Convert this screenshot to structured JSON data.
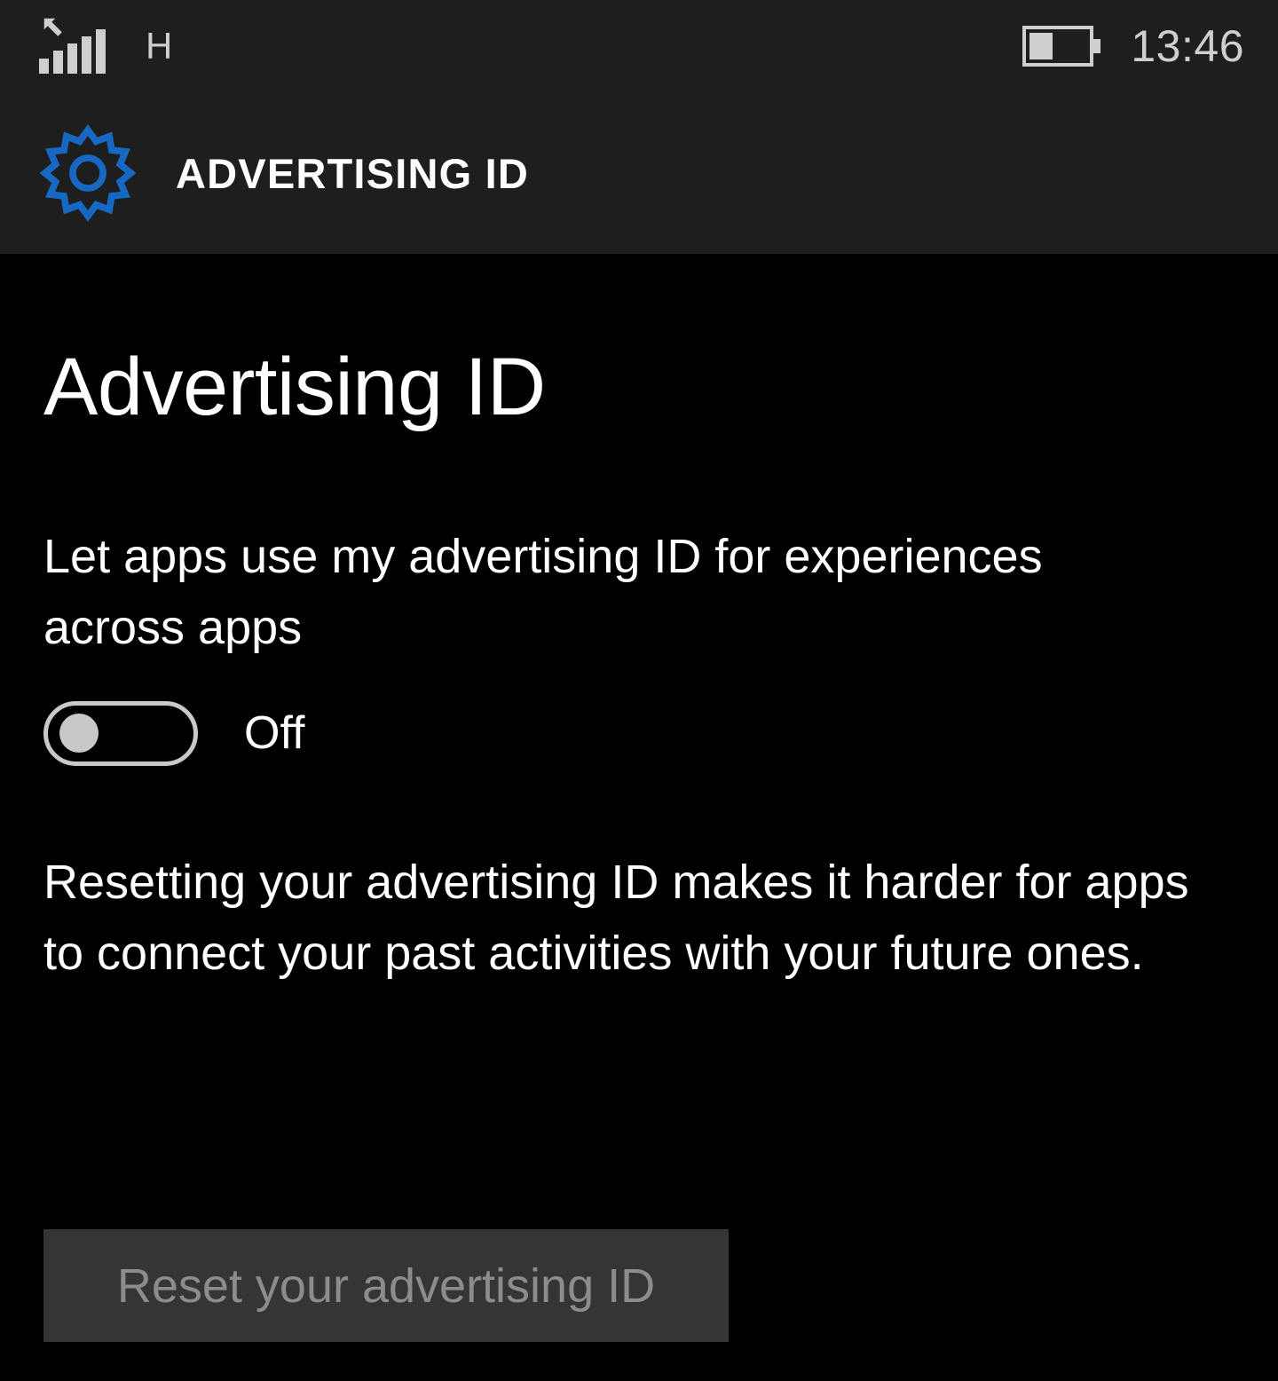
{
  "status_bar": {
    "signal_icon": "signal-bars-icon",
    "signal_bars_filled": 5,
    "signal_bars_total": 5,
    "roaming_icon": "roaming-arrow-icon",
    "network_type": "H",
    "battery_icon": "battery-icon",
    "battery_level_percent": 40,
    "time": "13:46"
  },
  "app_header": {
    "icon": "gear-icon",
    "icon_color": "#1668c3",
    "title": "ADVERTISING ID"
  },
  "page": {
    "title": "Advertising ID",
    "toggle_setting": {
      "label": "Let apps use my advertising ID for experiences across apps",
      "state_label": "Off",
      "checked": false
    },
    "reset_section": {
      "description": "Resetting your advertising ID makes it harder for apps to connect your past activities with your future ones.",
      "button_label": "Reset your advertising ID",
      "button_enabled": false
    }
  },
  "colors": {
    "background": "#000000",
    "header_background": "#1e1e1e",
    "accent_blue": "#1668c3",
    "status_icon_gray": "#cfcfcf",
    "toggle_gray": "#c8c8c8",
    "button_background": "#353535",
    "button_text": "#8c8c8c"
  }
}
